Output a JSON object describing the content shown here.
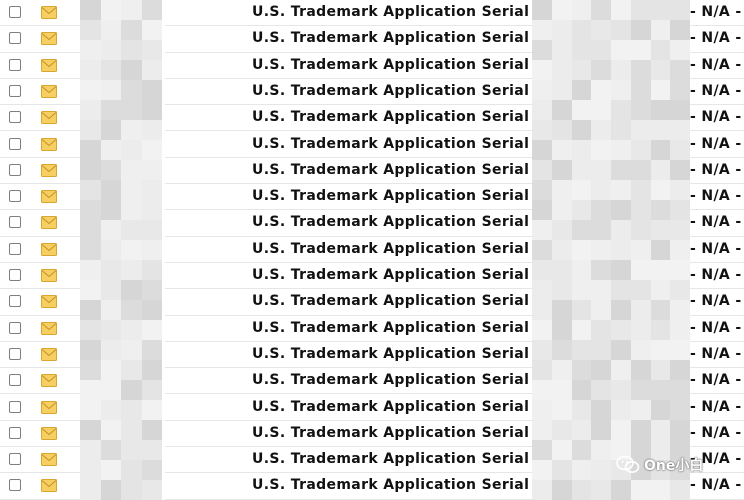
{
  "rows": [
    {
      "subject": "U.S. Trademark Application Serial No.",
      "status": "- N/A -"
    },
    {
      "subject": "U.S. Trademark Application Serial No.",
      "status": "- N/A -"
    },
    {
      "subject": "U.S. Trademark Application Serial No.",
      "status": "- N/A -"
    },
    {
      "subject": "U.S. Trademark Application Serial No.",
      "status": "- N/A -"
    },
    {
      "subject": "U.S. Trademark Application Serial No.",
      "status": "- N/A -"
    },
    {
      "subject": "U.S. Trademark Application Serial No.",
      "status": "- N/A -"
    },
    {
      "subject": "U.S. Trademark Application Serial No.",
      "status": "- N/A -"
    },
    {
      "subject": "U.S. Trademark Application Serial No.",
      "status": "- N/A -"
    },
    {
      "subject": "U.S. Trademark Application Serial No.",
      "status": "- N/A -"
    },
    {
      "subject": "U.S. Trademark Application Serial No.",
      "status": "- N/A -"
    },
    {
      "subject": "U.S. Trademark Application Serial No",
      "status": "- N/A -"
    },
    {
      "subject": "U.S. Trademark Application Serial No",
      "status": "- N/A -"
    },
    {
      "subject": "U.S. Trademark Application Serial No.",
      "status": "- N/A -"
    },
    {
      "subject": "U.S. Trademark Application Serial No.",
      "status": "- N/A -"
    },
    {
      "subject": "U.S. Trademark Application Serial No.",
      "status": "- N/A -"
    },
    {
      "subject": "U.S. Trademark Application Serial No.",
      "status": "- N/A -"
    },
    {
      "subject": "U.S. Trademark Application Serial No.",
      "status": "- N/A -"
    },
    {
      "subject": "U.S. Trademark Application Serial No",
      "status": "- N/A -"
    },
    {
      "subject": "U.S. Trademark Application Serial No.",
      "status": "- N/A -"
    }
  ],
  "watermark": {
    "text": "One小白"
  },
  "icons": {
    "checkbox": "checkbox-icon",
    "mail": "envelope-icon"
  },
  "colors": {
    "envelope": "#f2c14e",
    "redaction": "#e0e0e0"
  }
}
